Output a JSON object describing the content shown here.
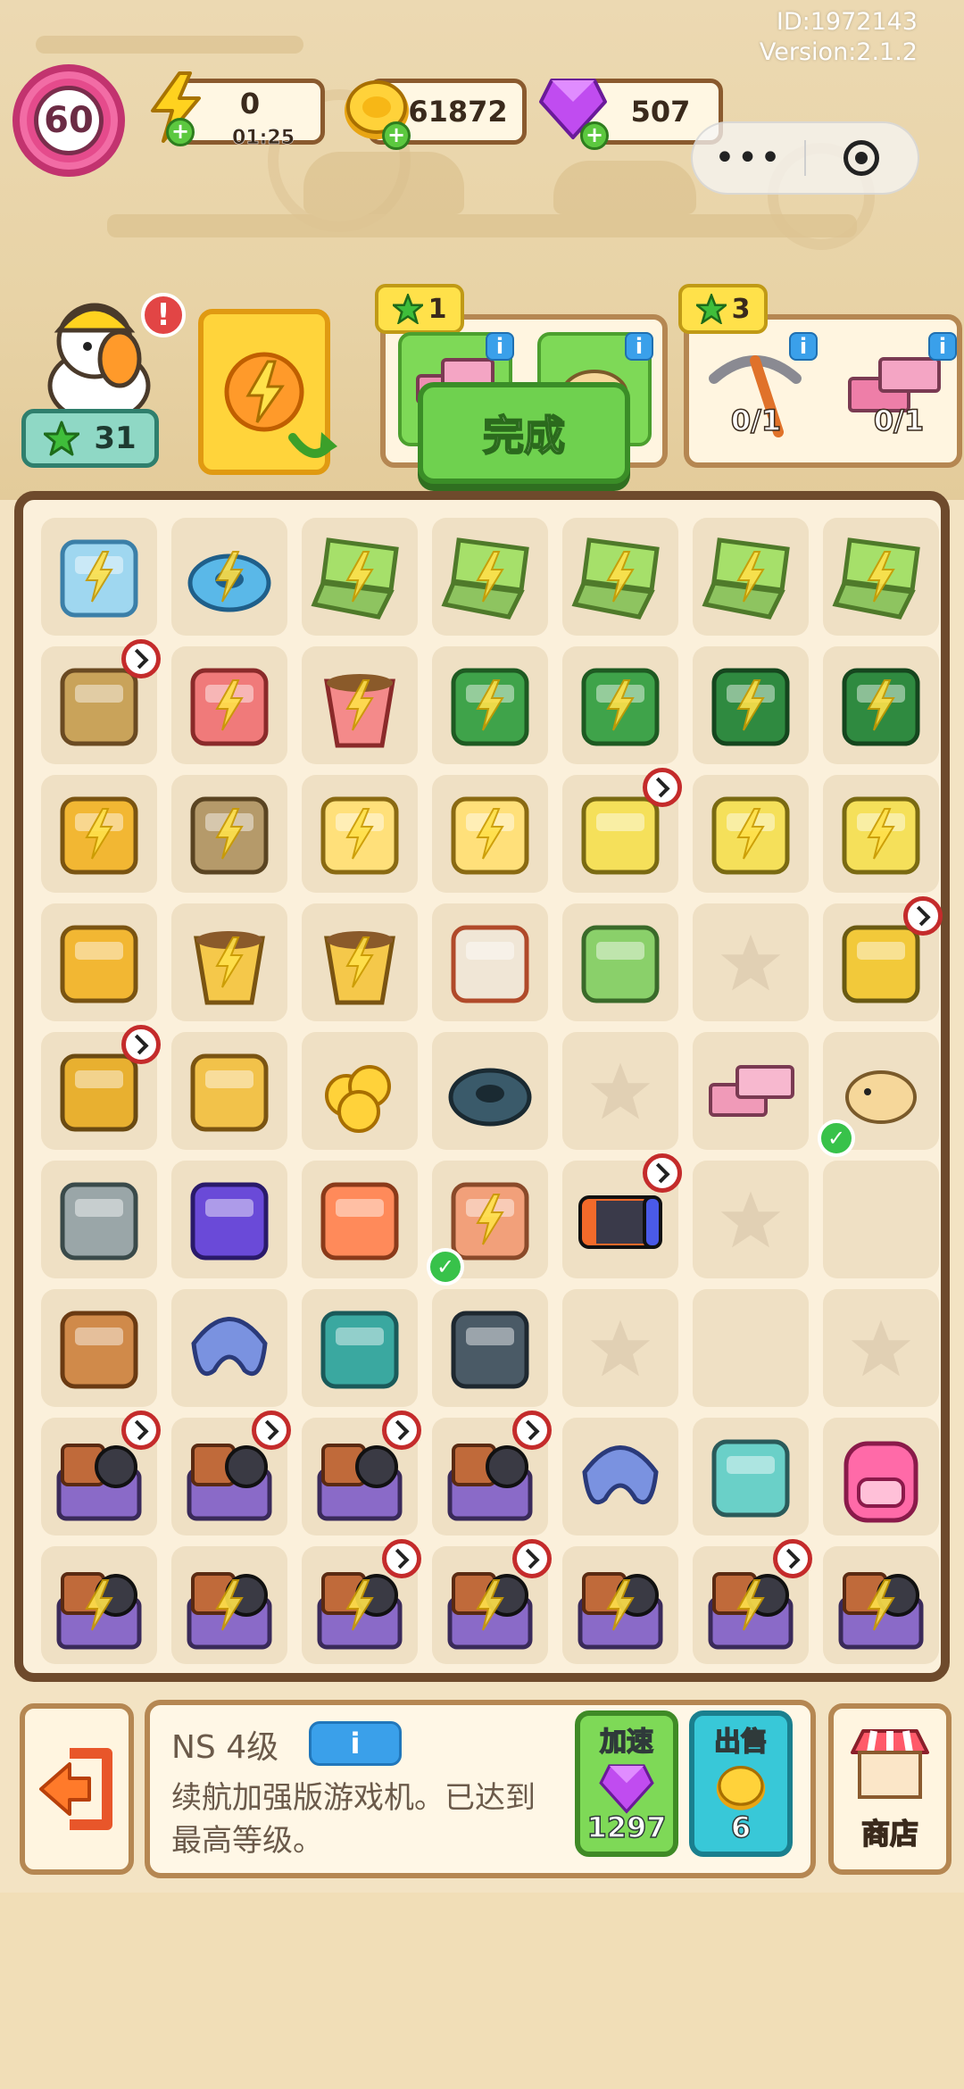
{
  "meta": {
    "id": "ID:1972143",
    "version": "Version:2.1.2"
  },
  "status": {
    "level": "60",
    "energy": "0",
    "energy_timer": "01:25",
    "coins": "61872",
    "gems": "507"
  },
  "miniprogram": {
    "more_icon": "more-dots-icon",
    "close_icon": "target-circle-icon"
  },
  "player": {
    "star_level": "31"
  },
  "quests": [
    {
      "stars": "1",
      "items": [
        "pink-bricks",
        "hamster"
      ],
      "done_label": "完成"
    },
    {
      "stars": "3",
      "items": [
        {
          "icon": "pickaxe",
          "progress": "0/1"
        },
        {
          "icon": "pink-bricks",
          "progress": "0/1"
        }
      ]
    }
  ],
  "board": {
    "rows": [
      [
        "robot-vacuum-dock",
        "robot-vacuum",
        "laptop",
        "laptop",
        "laptop",
        "laptop",
        "laptop"
      ],
      [
        "wheelbarrow-tools",
        "tool-basket",
        "tool-bucket",
        "green-toolbox",
        "green-toolbox",
        "green-tool-case",
        "green-tool-case"
      ],
      [
        "yellow-cabinet",
        "wooden-cabinet",
        "shopping-cart-duck",
        "shopping-cart-duck",
        "cart-weights",
        "cart-weights",
        "cart-weights"
      ],
      [
        "yellow-drawer",
        "plant-pot",
        "plant-pot",
        "paint-can",
        "spray-bottle",
        "empty",
        "cart-wood"
      ],
      [
        "drawer-plant",
        "cardboard-box",
        "gold-coins",
        "weight-plates",
        "empty",
        "pink-bricks",
        "hamster"
      ],
      [
        "nail-gun",
        "purple-goggles",
        "headphones",
        "brick-stack",
        "game-console",
        "empty",
        "blank"
      ],
      [
        "leather-stool",
        "neck-pillow",
        "exercise-bench-small",
        "dark-bag",
        "empty",
        "blank",
        "empty"
      ],
      [
        "gaming-chest",
        "gaming-chest",
        "gaming-chest",
        "gaming-chest",
        "neck-pillow",
        "bench-press",
        "pink-backpack"
      ],
      [
        "gaming-chest",
        "gaming-chest",
        "gaming-chest",
        "gaming-chest",
        "gaming-chest",
        "gaming-chest",
        "gaming-chest"
      ]
    ]
  },
  "selected": {
    "title": "NS 4级",
    "info_label": "i",
    "description": "续航加强版游戏机。已达到最高等级。"
  },
  "actions": {
    "speedup": {
      "label": "加速",
      "cost": "1297"
    },
    "sell": {
      "label": "出售",
      "price": "6"
    },
    "shop": {
      "label": "商店"
    }
  },
  "colors": {
    "level_ring": "#e54b8c",
    "done_button": "#6fd14f",
    "speedup_button": "#7ed957",
    "sell_button": "#38c8d8",
    "board_frame": "#6e4a2c"
  }
}
